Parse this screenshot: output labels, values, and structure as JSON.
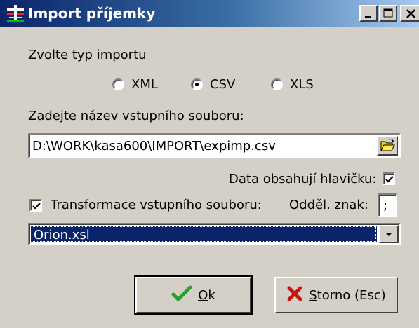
{
  "window": {
    "title": "Import příjemky"
  },
  "import_type": {
    "label": "Zvolte typ importu",
    "options": [
      {
        "label": "XML",
        "selected": false
      },
      {
        "label": "CSV",
        "selected": true
      },
      {
        "label": "XLS",
        "selected": false
      }
    ]
  },
  "input_file": {
    "label": "Zadejte název vstupního souboru:",
    "value": "D:\\WORK\\kasa600\\IMPORT\\expimp.csv",
    "browse_icon": "folder-open-icon"
  },
  "header_checkbox": {
    "label": "Data obsahují hlavičku:",
    "checked": true
  },
  "transform_checkbox": {
    "label": "Transformace vstupního souboru:",
    "checked": true
  },
  "separator": {
    "label": "Odděl. znak:",
    "value": ";"
  },
  "transform_combo": {
    "value": "Orion.xsl"
  },
  "buttons": {
    "ok": "Ok",
    "cancel": "Storno (Esc)"
  },
  "colors": {
    "face": "#d4d0c8",
    "title_start": "#0a246a",
    "title_end": "#a6caf0",
    "selection": "#0a246a",
    "ok_check": "#2aa02a",
    "cancel_x": "#d01010"
  }
}
